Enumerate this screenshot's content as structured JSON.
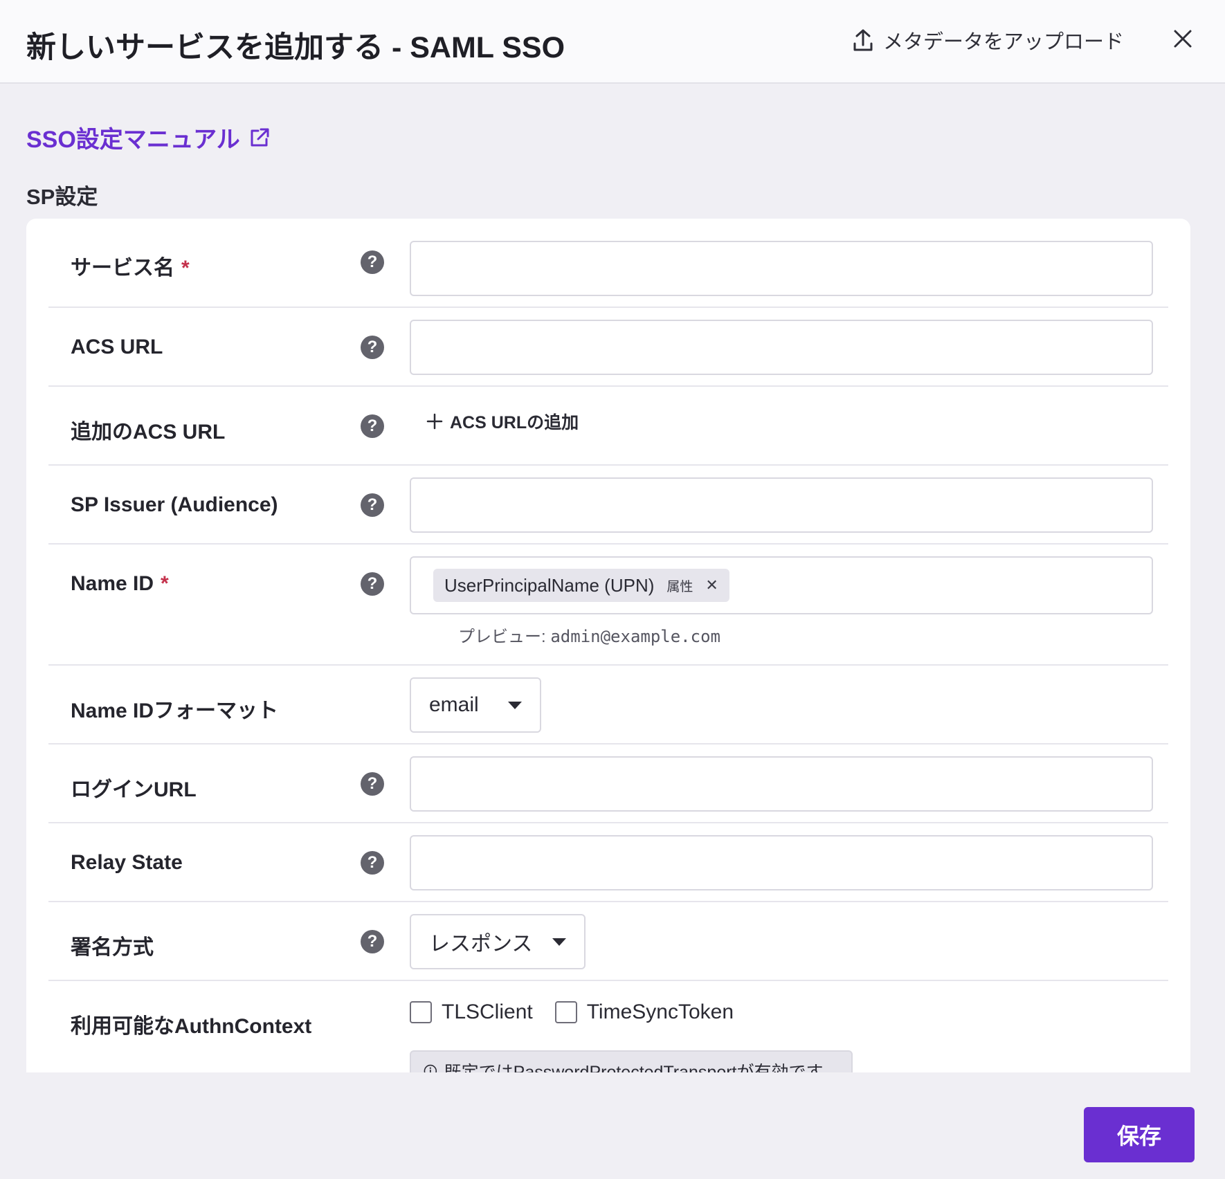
{
  "header": {
    "title": "新しいサービスを追加する - SAML SSO",
    "upload_label": "メタデータをアップロード"
  },
  "manual_link": "SSO設定マニュアル",
  "section_title": "SP設定",
  "fields": {
    "service_name": {
      "label": "サービス名",
      "required": "*"
    },
    "acs_url": {
      "label": "ACS URL"
    },
    "additional_acs": {
      "label": "追加のACS URL",
      "add_label": "ACS URLの追加"
    },
    "sp_issuer": {
      "label": "SP Issuer (Audience)"
    },
    "name_id": {
      "label": "Name ID",
      "required": "*",
      "chip_value": "UserPrincipalName (UPN)",
      "chip_tag": "属性",
      "preview_label": "プレビュー:",
      "preview_value": "admin@example.com"
    },
    "name_id_format": {
      "label": "Name IDフォーマット",
      "value": "email"
    },
    "login_url": {
      "label": "ログインURL"
    },
    "relay_state": {
      "label": "Relay State"
    },
    "signing_method": {
      "label": "署名方式",
      "value": "レスポンス"
    },
    "authn_context": {
      "label": "利用可能なAuthnContext",
      "options": [
        "TLSClient",
        "TimeSyncToken"
      ],
      "info": "既定ではPasswordProtectedTransportが有効です。"
    }
  },
  "save_label": "保存",
  "colors": {
    "accent": "#6a2fd1",
    "required": "#c4314b",
    "background": "#f0eff4"
  }
}
